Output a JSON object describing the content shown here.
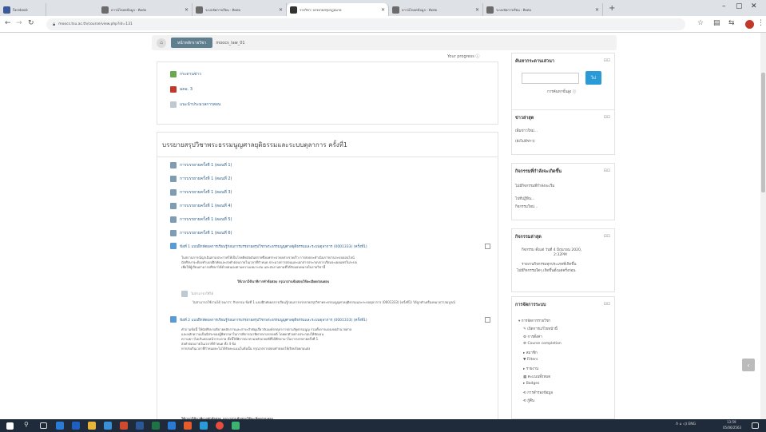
{
  "browser": {
    "tabs": [
      {
        "title": "Facebook",
        "favicon_color": "#3b5998",
        "active": false
      },
      {
        "title": "ดาวน์โหลดข้อมูล - ติดต่อ",
        "favicon_color": "#6b6b6b",
        "active": false
      },
      {
        "title": "ระบบจัดการเรียน - ติดต่อ",
        "favicon_color": "#6b6b6b",
        "active": false
      },
      {
        "title": "รายวิชา: บรรยายสรุปกฎหมาย",
        "favicon_color": "#333333",
        "active": true
      },
      {
        "title": "ดาวน์โหลดข้อมูล - ติดต่อ",
        "favicon_color": "#6b6b6b",
        "active": false
      },
      {
        "title": "ระบบจัดการเรียน - ติดต่อ",
        "favicon_color": "#6b6b6b",
        "active": false
      }
    ],
    "url": "moocs.tsu.ac.th/course/view.php?id=131"
  },
  "breadcrumb": {
    "home_icon": "home-icon",
    "pill": "หน้าหลักรายวิชา",
    "current": "moocs_law_01"
  },
  "progress_label": "Your progress ⓘ",
  "top_section": {
    "items": [
      {
        "icon": "forum-icon",
        "label": "กระดานข่าว"
      },
      {
        "icon": "pdf-icon",
        "label": "มคอ. 3"
      },
      {
        "icon": "page-icon",
        "label": "แนะนำประมวลการสอน"
      }
    ]
  },
  "main_section": {
    "title": "บรรยายสรุปวิชาพระธรรมนูญศาลยุติธรรมและระบบตุลาการ ครั้งที่1",
    "files": [
      "การบรรยายครั้งที่ 1 (ตอนที่ 1)",
      "การบรรยายครั้งที่ 1 (ตอนที่ 2)",
      "การบรรยายครั้งที่ 1 (ตอนที่ 3)",
      "การบรรยายครั้งที่ 1 (ตอนที่ 4)",
      "การบรรยายครั้งที่ 1 (ตอนที่ 5)",
      "การบรรยายครั้งที่ 1 (ตอนที่ 6)"
    ],
    "assign1": {
      "title": "ข้อที่ 1 แบบฝึกหัดผลการเรียนรู้ก่อนการบรรยายสรุปวิชาพระธรรมนูญศาลยุติธรรมและระบบตุลาการ (0001333) (ครั้งที่1)",
      "desc": [
        "ในสถานการณ์ฉุกเฉินตามประกาศให้เป็นโรคติดต่ออันตรายซึ่งแพร่ระบาดอย่างรวดเร็ว การสอบจะดำเนินการผ่านระบบออนไลน์",
        "นักศึกษาจะต้องทำแบบฝึกหัดและส่งคำตอบภายในเวลาที่กำหนด ประมวลการสอนและเอกสารประกอบการเรียนจะเผยแพร่ในระบบ",
        "เพื่อให้ผู้เรียนสามารถศึกษาได้ด้วยตนเองตามความเหมาะสม และส่งงานตามที่ได้รับมอบหมายในรายวิชานี้"
      ],
      "note": "ให้เวลา50นาทีการทำข้อสอบ กรุณาอ่านข้อสอบให้ละเอียดก่อนตอบ"
    },
    "restricted": {
      "label": "ไม่สามารถใช้ได้",
      "text": "ไม่สามารถใช้งานได้ จนกว่า: กิจกรรม ข้อที่ 1 แบบฝึกหัดผลการเรียนรู้ก่อนการบรรยายสรุปวิชาพระธรรมนูญศาลยุติธรรมและระบบตุลาการ (0001333) (ครั้งที่1) ได้ถูกทำเครื่องหมายว่าสมบูรณ์"
    },
    "assign2": {
      "title": "ข้อที่ 2 แบบฝึกหัดผลการเรียนรู้ก่อนการบรรยายสรุปวิชาพระธรรมนูญศาลยุติธรรมและระบบตุลาการ (0001333) (ครั้งที่1)",
      "desc": [
        "คำถามข้อนี้ ให้นักศึกษาอธิบายหลักการและสาระสำคัญเกี่ยวกับองค์กรตุลาการตามรัฐธรรมนูญ รวมทั้งการแบ่งเขตอำนาจศาล",
        "และหลักความเป็นอิสระของผู้พิพากษาในการพิจารณาพิพากษาอรรถคดี โดยยกตัวอย่างประกอบให้ชัดเจน",
        "ความยาวไม่เกินสองหน้ากระดาษ ทั้งนี้ให้พิจารณาตามหลักเกณฑ์ที่ได้ศึกษามาในการบรรยายครั้งที่ 1",
        "ส่งคำตอบภายในเวลาที่กำหนด ทั้ง 4 ข้อ",
        "หากส่งเกินเวลาที่กำหนดจะไม่ได้รับคะแนนในข้อนั้น กรุณาตรวจสอบคำตอบให้เรียบร้อยก่อนส่ง"
      ],
      "note": "ให้เวลา50นาทีการทำข้อสอบ กรุณาอ่านข้อสอบให้ละเอียดก่อนตอบ"
    }
  },
  "blocks": {
    "search": {
      "title": "ค้นหากระดานเสวนา",
      "button": "ไป",
      "advanced": "การค้นหาขั้นสูง ⓘ"
    },
    "news": {
      "title": "ข่าวล่าสุด",
      "lines": [
        "เพิ่มข่าวใหม่...",
        "(ยังไม่มีข่าว)"
      ]
    },
    "upcoming": {
      "title": "กิจกรรมที่กำลังจะเกิดขึ้น",
      "lines": [
        "ไม่มีกิจกรรมที่กำลังจะเริ่ม",
        "ไปที่ปฏิทิน...",
        "กิจกรรมใหม่..."
      ]
    },
    "recent": {
      "title": "กิจกรรมล่าสุด",
      "lines": [
        "กิจกรรม ตั้งแต่ วันที่ 4 มิถุนายน 2020,",
        "2:32PM",
        "รายงานกิจกรรมทุกประเภทที่เกิดขึ้น",
        "ไม่มีกิจกรรมใดๆ เกิดขึ้นตั้งแต่ครั้งก่อน"
      ]
    },
    "admin": {
      "title": "การจัดการระบบ",
      "items": [
        "▾ การจัดการรายวิชา",
        "✎ เปิดการแก้ไขหน้านี้",
        "⚙ การตั้งค่า",
        "⚙ Course completion",
        "▸ สมาชิก",
        "▼ Filters",
        "▸ รายงาน",
        "▦ คะแนนทั้งหมด",
        "▸ Badges",
        "⟲ การสำรองข้อมูล",
        "⟲ กู้คืน"
      ]
    }
  },
  "taskbar": {
    "time": "13:59",
    "date": "05/06/2563",
    "tray": "ᐱ  ⌂ ◁) ENG"
  },
  "colors": {
    "accent": "#2a9bd6",
    "breadcrumb_pill": "#5f7e8e",
    "taskbar": "#1f2a3a"
  }
}
